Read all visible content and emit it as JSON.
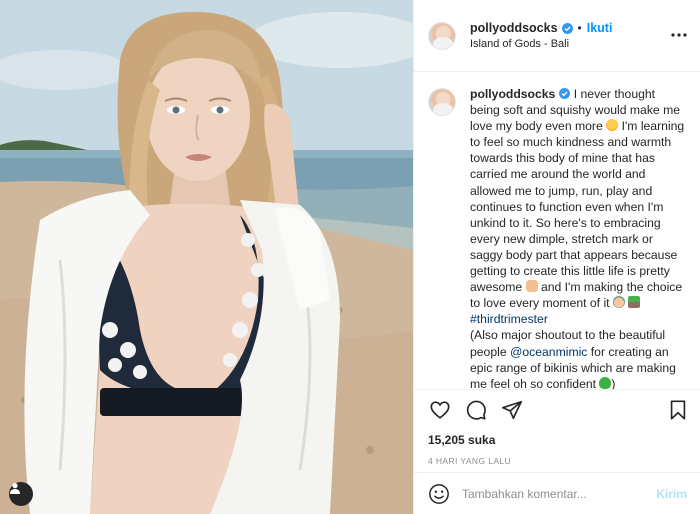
{
  "post": {
    "image_alt": "Woman on a beach wearing an open white shirt and polka-dot bikini top"
  },
  "header": {
    "username": "pollyoddsocks",
    "separator": "•",
    "follow_label": "Ikuti",
    "location": "Island of Gods - Bali"
  },
  "caption": {
    "username": "pollyoddsocks",
    "line_1": "I never thought being soft and squishy would make me love my body even more",
    "line_2": "I'm learning to feel so much kindness and warmth towards this body of mine that has carried me around the world and allowed me to jump, run, play and continues to function even when I'm unkind to it. So here's to embracing every new dimple, stretch mark or saggy body part that appears because getting to create this little life is pretty awesome",
    "line_3": "and I'm making the choice to love every moment of it",
    "hashtag": "#thirdtrimester",
    "line_4": "(Also major shoutout to the beautiful people",
    "mention": "@oceanmimic",
    "line_5": "for creating an epic range of bikinis which are making me feel oh so confident",
    "line_6": ")"
  },
  "actions": {
    "like_icon": "heart-icon",
    "comment_icon": "comment-icon",
    "share_icon": "paper-plane-icon",
    "save_icon": "bookmark-icon"
  },
  "likes": {
    "text": "15,205 suka"
  },
  "timestamp": {
    "text": "4 HARI YANG LALU"
  },
  "comment_box": {
    "placeholder": "Tambahkan komentar...",
    "post_label": "Kirim"
  },
  "colors": {
    "accent": "#0095f6",
    "verified": "#3897f0",
    "post_disabled": "#b2dffc",
    "muted": "#8e8e8e"
  }
}
